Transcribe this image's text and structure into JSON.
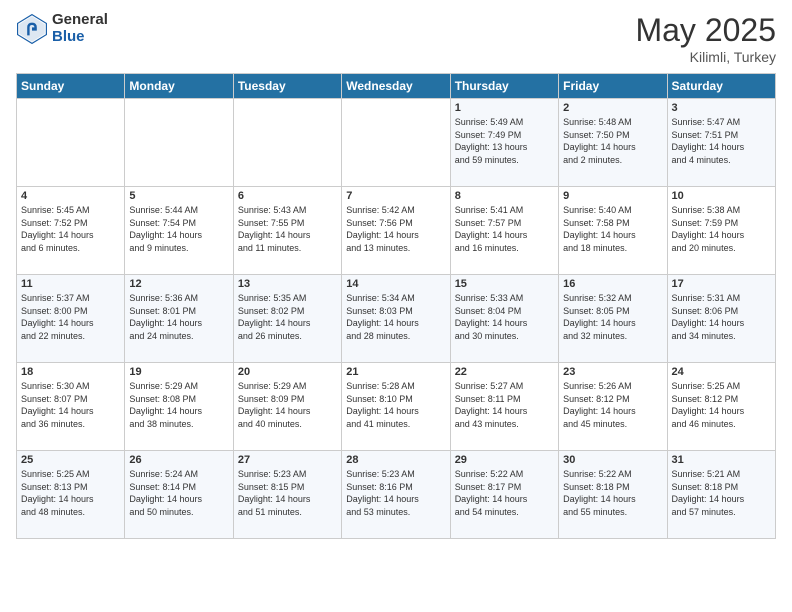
{
  "logo": {
    "general": "General",
    "blue": "Blue"
  },
  "title": {
    "month_year": "May 2025",
    "location": "Kilimli, Turkey"
  },
  "header": {
    "days": [
      "Sunday",
      "Monday",
      "Tuesday",
      "Wednesday",
      "Thursday",
      "Friday",
      "Saturday"
    ]
  },
  "weeks": [
    [
      {
        "day": "",
        "info": ""
      },
      {
        "day": "",
        "info": ""
      },
      {
        "day": "",
        "info": ""
      },
      {
        "day": "",
        "info": ""
      },
      {
        "day": "1",
        "info": "Sunrise: 5:49 AM\nSunset: 7:49 PM\nDaylight: 13 hours\nand 59 minutes."
      },
      {
        "day": "2",
        "info": "Sunrise: 5:48 AM\nSunset: 7:50 PM\nDaylight: 14 hours\nand 2 minutes."
      },
      {
        "day": "3",
        "info": "Sunrise: 5:47 AM\nSunset: 7:51 PM\nDaylight: 14 hours\nand 4 minutes."
      }
    ],
    [
      {
        "day": "4",
        "info": "Sunrise: 5:45 AM\nSunset: 7:52 PM\nDaylight: 14 hours\nand 6 minutes."
      },
      {
        "day": "5",
        "info": "Sunrise: 5:44 AM\nSunset: 7:54 PM\nDaylight: 14 hours\nand 9 minutes."
      },
      {
        "day": "6",
        "info": "Sunrise: 5:43 AM\nSunset: 7:55 PM\nDaylight: 14 hours\nand 11 minutes."
      },
      {
        "day": "7",
        "info": "Sunrise: 5:42 AM\nSunset: 7:56 PM\nDaylight: 14 hours\nand 13 minutes."
      },
      {
        "day": "8",
        "info": "Sunrise: 5:41 AM\nSunset: 7:57 PM\nDaylight: 14 hours\nand 16 minutes."
      },
      {
        "day": "9",
        "info": "Sunrise: 5:40 AM\nSunset: 7:58 PM\nDaylight: 14 hours\nand 18 minutes."
      },
      {
        "day": "10",
        "info": "Sunrise: 5:38 AM\nSunset: 7:59 PM\nDaylight: 14 hours\nand 20 minutes."
      }
    ],
    [
      {
        "day": "11",
        "info": "Sunrise: 5:37 AM\nSunset: 8:00 PM\nDaylight: 14 hours\nand 22 minutes."
      },
      {
        "day": "12",
        "info": "Sunrise: 5:36 AM\nSunset: 8:01 PM\nDaylight: 14 hours\nand 24 minutes."
      },
      {
        "day": "13",
        "info": "Sunrise: 5:35 AM\nSunset: 8:02 PM\nDaylight: 14 hours\nand 26 minutes."
      },
      {
        "day": "14",
        "info": "Sunrise: 5:34 AM\nSunset: 8:03 PM\nDaylight: 14 hours\nand 28 minutes."
      },
      {
        "day": "15",
        "info": "Sunrise: 5:33 AM\nSunset: 8:04 PM\nDaylight: 14 hours\nand 30 minutes."
      },
      {
        "day": "16",
        "info": "Sunrise: 5:32 AM\nSunset: 8:05 PM\nDaylight: 14 hours\nand 32 minutes."
      },
      {
        "day": "17",
        "info": "Sunrise: 5:31 AM\nSunset: 8:06 PM\nDaylight: 14 hours\nand 34 minutes."
      }
    ],
    [
      {
        "day": "18",
        "info": "Sunrise: 5:30 AM\nSunset: 8:07 PM\nDaylight: 14 hours\nand 36 minutes."
      },
      {
        "day": "19",
        "info": "Sunrise: 5:29 AM\nSunset: 8:08 PM\nDaylight: 14 hours\nand 38 minutes."
      },
      {
        "day": "20",
        "info": "Sunrise: 5:29 AM\nSunset: 8:09 PM\nDaylight: 14 hours\nand 40 minutes."
      },
      {
        "day": "21",
        "info": "Sunrise: 5:28 AM\nSunset: 8:10 PM\nDaylight: 14 hours\nand 41 minutes."
      },
      {
        "day": "22",
        "info": "Sunrise: 5:27 AM\nSunset: 8:11 PM\nDaylight: 14 hours\nand 43 minutes."
      },
      {
        "day": "23",
        "info": "Sunrise: 5:26 AM\nSunset: 8:12 PM\nDaylight: 14 hours\nand 45 minutes."
      },
      {
        "day": "24",
        "info": "Sunrise: 5:25 AM\nSunset: 8:12 PM\nDaylight: 14 hours\nand 46 minutes."
      }
    ],
    [
      {
        "day": "25",
        "info": "Sunrise: 5:25 AM\nSunset: 8:13 PM\nDaylight: 14 hours\nand 48 minutes."
      },
      {
        "day": "26",
        "info": "Sunrise: 5:24 AM\nSunset: 8:14 PM\nDaylight: 14 hours\nand 50 minutes."
      },
      {
        "day": "27",
        "info": "Sunrise: 5:23 AM\nSunset: 8:15 PM\nDaylight: 14 hours\nand 51 minutes."
      },
      {
        "day": "28",
        "info": "Sunrise: 5:23 AM\nSunset: 8:16 PM\nDaylight: 14 hours\nand 53 minutes."
      },
      {
        "day": "29",
        "info": "Sunrise: 5:22 AM\nSunset: 8:17 PM\nDaylight: 14 hours\nand 54 minutes."
      },
      {
        "day": "30",
        "info": "Sunrise: 5:22 AM\nSunset: 8:18 PM\nDaylight: 14 hours\nand 55 minutes."
      },
      {
        "day": "31",
        "info": "Sunrise: 5:21 AM\nSunset: 8:18 PM\nDaylight: 14 hours\nand 57 minutes."
      }
    ]
  ]
}
